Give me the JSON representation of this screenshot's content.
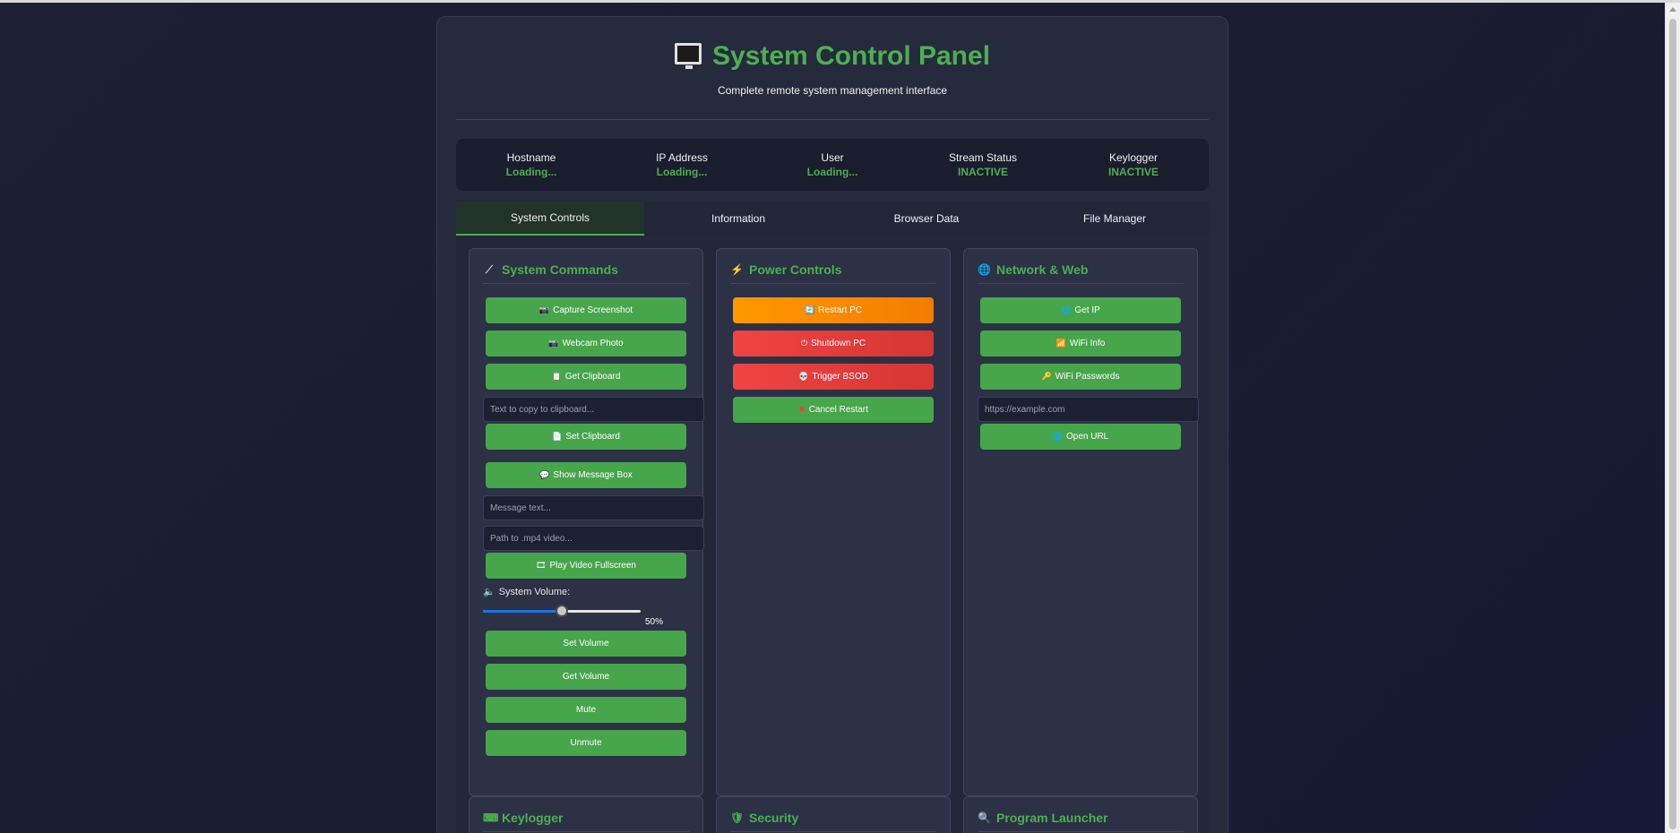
{
  "header": {
    "title": "System Control Panel",
    "subtitle": "Complete remote system management interface"
  },
  "status": [
    {
      "label": "Hostname",
      "value": "Loading..."
    },
    {
      "label": "IP Address",
      "value": "Loading..."
    },
    {
      "label": "User",
      "value": "Loading..."
    },
    {
      "label": "Stream Status",
      "value": "INACTIVE"
    },
    {
      "label": "Keylogger",
      "value": "INACTIVE"
    }
  ],
  "tabs": [
    {
      "label": "System Controls",
      "active": true
    },
    {
      "label": "Information",
      "active": false
    },
    {
      "label": "Browser Data",
      "active": false
    },
    {
      "label": "File Manager",
      "active": false
    }
  ],
  "system_commands": {
    "title": "System Commands",
    "capture_screenshot": "Capture Screenshot",
    "webcam_photo": "Webcam Photo",
    "get_clipboard": "Get Clipboard",
    "clipboard_placeholder": "Text to copy to clipboard...",
    "set_clipboard": "Set Clipboard",
    "show_message_box": "Show Message Box",
    "message_placeholder": "Message text...",
    "video_placeholder": "Path to .mp4 video...",
    "play_video": "Play Video Fullscreen",
    "volume_label": "System Volume:",
    "volume_value": "50%",
    "volume_level": 0.5,
    "set_volume": "Set Volume",
    "get_volume": "Get Volume",
    "mute": "Mute",
    "unmute": "Unmute"
  },
  "power_controls": {
    "title": "Power Controls",
    "restart": "Restart PC",
    "shutdown": "Shutdown PC",
    "bsod": "Trigger BSOD",
    "cancel_restart": "Cancel Restart"
  },
  "network_web": {
    "title": "Network & Web",
    "get_ip": "Get IP",
    "wifi_info": "WiFi Info",
    "wifi_passwords": "WiFi Passwords",
    "url_placeholder": "https://example.com",
    "open_url": "Open URL"
  },
  "bottom_cards": {
    "keylogger": "Keylogger",
    "security": "Security",
    "program_launcher": "Program Launcher"
  },
  "icons": {
    "title": "monitor-icon",
    "system_commands": "wand-icon",
    "power_controls": "lightning-icon",
    "network_web": "globe-icon"
  },
  "colors": {
    "accent": "#4caf50",
    "orange": "#ff9800",
    "red": "#e53935",
    "background": "#1c1f33",
    "panel": "#262a3d"
  }
}
